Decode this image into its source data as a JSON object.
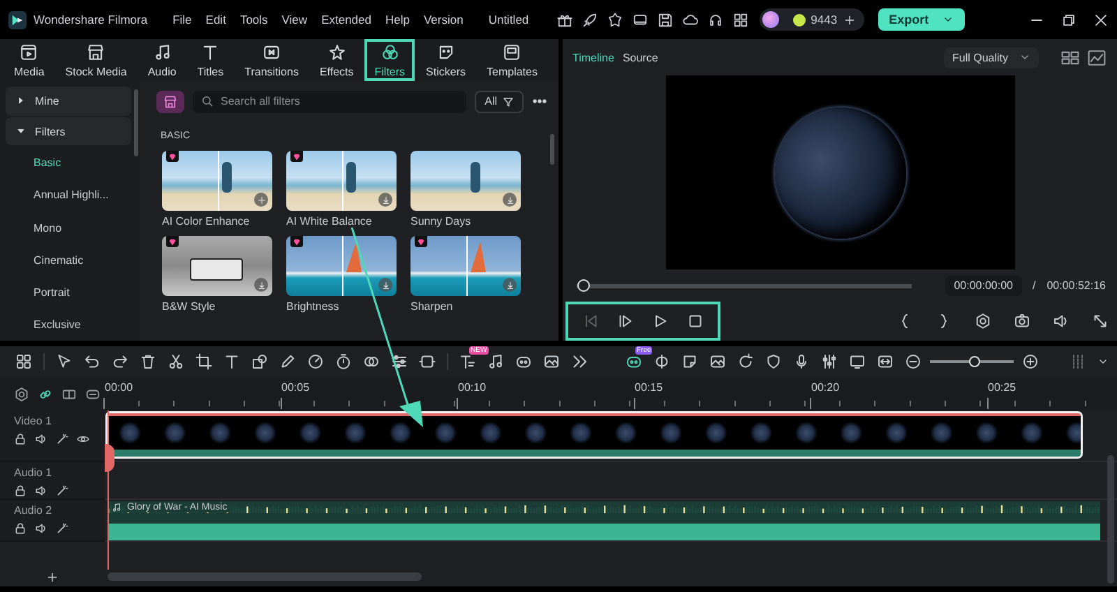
{
  "app": {
    "name": "Wondershare Filmora",
    "menu": [
      "File",
      "Edit",
      "Tools",
      "View",
      "Extended",
      "Help",
      "Version"
    ],
    "project_title": "Untitled",
    "credits": "9443",
    "export_button": "Export"
  },
  "library": {
    "tabs": [
      {
        "label": "Media",
        "selected": false
      },
      {
        "label": "Stock Media",
        "selected": false
      },
      {
        "label": "Audio",
        "selected": false
      },
      {
        "label": "Titles",
        "selected": false
      },
      {
        "label": "Transitions",
        "selected": false
      },
      {
        "label": "Effects",
        "selected": false
      },
      {
        "label": "Filters",
        "selected": true
      },
      {
        "label": "Stickers",
        "selected": false
      },
      {
        "label": "Templates",
        "selected": false
      }
    ],
    "sidebar": [
      {
        "label": "Mine",
        "kind": "group",
        "expanded": false
      },
      {
        "label": "Filters",
        "kind": "group",
        "expanded": true
      },
      {
        "label": "Basic",
        "kind": "category",
        "selected": true
      },
      {
        "label": "Annual Highli...",
        "kind": "category",
        "selected": false
      },
      {
        "label": "Mono",
        "kind": "category",
        "selected": false
      },
      {
        "label": "Cinematic",
        "kind": "category",
        "selected": false
      },
      {
        "label": "Portrait",
        "kind": "category",
        "selected": false
      },
      {
        "label": "Exclusive",
        "kind": "category",
        "selected": false
      }
    ],
    "search_placeholder": "Search all filters",
    "scope": "All",
    "section": "BASIC",
    "filters": [
      {
        "name": "AI Color Enhance",
        "kind": "beach",
        "premium": true,
        "split": true,
        "downloaded": true
      },
      {
        "name": "AI White Balance",
        "kind": "beach",
        "premium": true,
        "split": true,
        "downloaded": false
      },
      {
        "name": "Sunny Days",
        "kind": "beach",
        "premium": false,
        "split": false,
        "downloaded": false
      },
      {
        "name": "B&W Style",
        "kind": "bus",
        "premium": true,
        "split": false,
        "downloaded": false
      },
      {
        "name": "Brightness",
        "kind": "sail",
        "premium": true,
        "split": true,
        "downloaded": false
      },
      {
        "name": "Sharpen",
        "kind": "sail",
        "premium": true,
        "split": true,
        "downloaded": false
      }
    ]
  },
  "preview": {
    "tabs": [
      {
        "label": "Timeline",
        "selected": true
      },
      {
        "label": "Source",
        "selected": false
      }
    ],
    "quality": "Full Quality",
    "progress": {
      "level": 0
    },
    "current_time": "00:00:00:00",
    "separator": "/",
    "duration": "00:00:52:16"
  },
  "timeline": {
    "new_badge": "NEW",
    "free_badge": "Free",
    "zoom": {
      "level": 0.53
    },
    "ruler": [
      "00:00",
      "00:05",
      "00:10",
      "00:15",
      "00:20",
      "00:25"
    ],
    "tracks": [
      {
        "name": "Video 1",
        "kind": "video",
        "selected": true
      },
      {
        "name": "Audio 1",
        "kind": "audio"
      },
      {
        "name": "Audio 2",
        "kind": "music",
        "clip_title": "Glory of War - AI Music"
      }
    ]
  },
  "annotations": {
    "playback_highlight": true,
    "arrow": true
  }
}
